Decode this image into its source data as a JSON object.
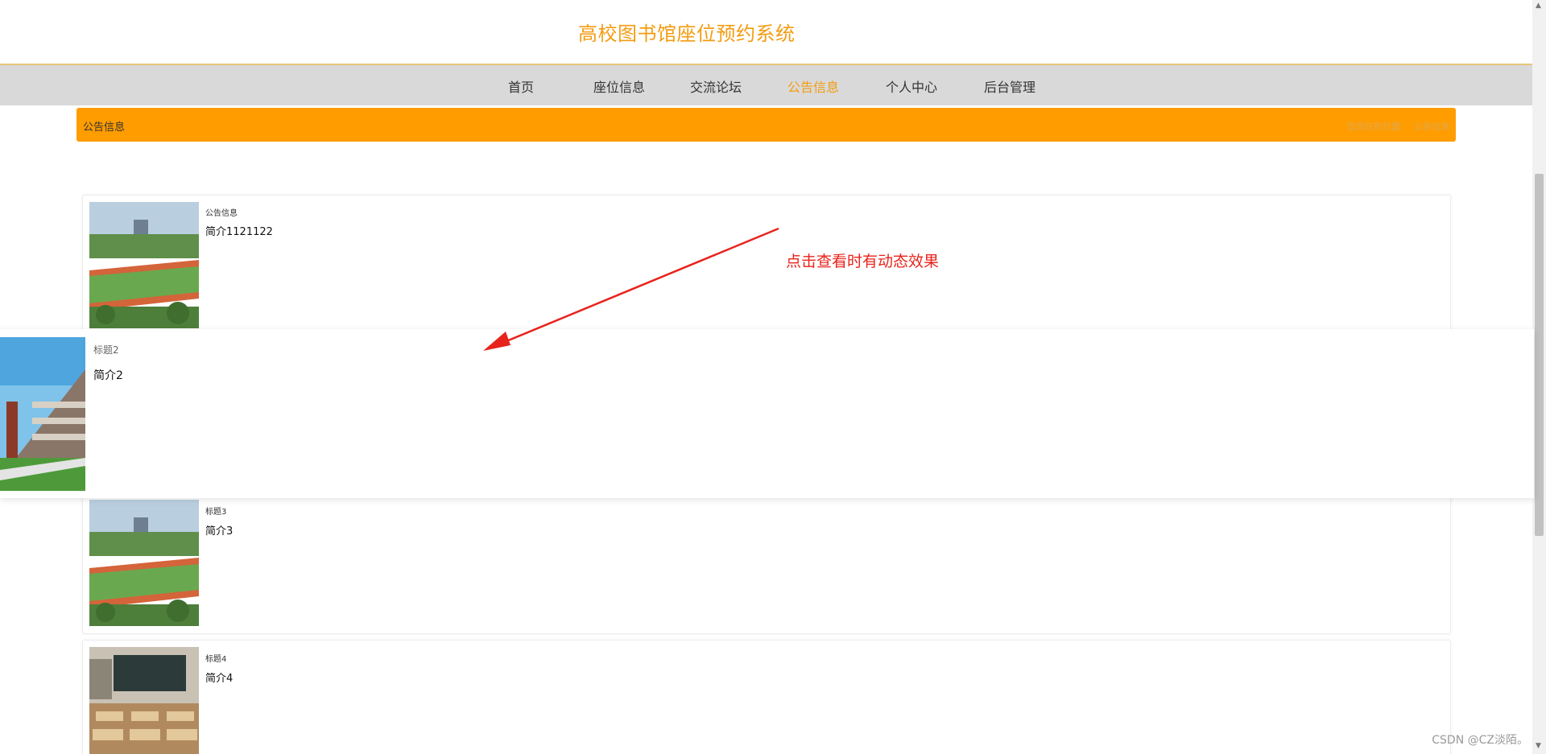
{
  "header": {
    "site_title": "高校图书馆座位预约系统"
  },
  "nav": {
    "items": [
      {
        "label": "首页",
        "active": false
      },
      {
        "label": "座位信息",
        "active": false
      },
      {
        "label": "交流论坛",
        "active": false
      },
      {
        "label": "公告信息",
        "active": true
      },
      {
        "label": "个人中心",
        "active": false
      },
      {
        "label": "后台管理",
        "active": false
      }
    ]
  },
  "breadcrumb": {
    "title": "公告信息",
    "path_current_label": "您现在的位置：",
    "path_page": "公告信息"
  },
  "notices": [
    {
      "title": "公告信息",
      "desc": "简介1121122",
      "thumb": "sports-field-image"
    },
    {
      "title": "标题2",
      "desc": "简介2",
      "thumb": "campus-building-image"
    },
    {
      "title": "标题3",
      "desc": "简介3",
      "thumb": "sports-field-image"
    },
    {
      "title": "标题4",
      "desc": "简介4",
      "thumb": "classroom-image"
    }
  ],
  "annotation": {
    "text": "点击查看时有动态效果"
  },
  "watermark": "CSDN @CZ淡陌。",
  "colors": {
    "accent": "#f39c12",
    "crumb_bar": "#ff9c00",
    "nav_bg": "#d9d9d9",
    "annotation": "#e8231c"
  }
}
